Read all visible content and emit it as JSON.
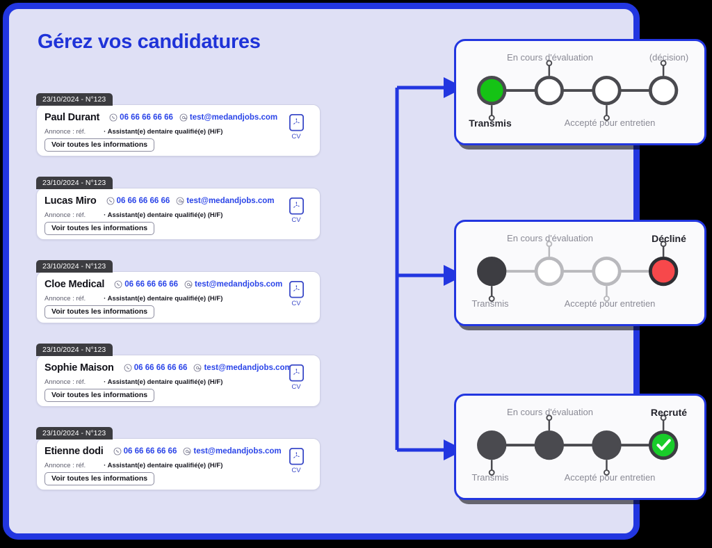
{
  "page": {
    "heading": "Gérez vos candidatures",
    "accent_blue": "#2236e0",
    "bg_panel": "#dfe0f5",
    "link_blue": "#2b45e8",
    "outer_bg": "#000000"
  },
  "candidates": [
    {
      "date_tag": "23/10/2024 - N°123",
      "name": "Paul Durant",
      "phone": "06 66 66 66 66",
      "email": "test@medandjobs.com",
      "annonce_label": "Annonce : réf.",
      "annonce_ref": "· Assistant(e) dentaire qualifié(e) (H/F)",
      "see_all": "Voir toutes les informations",
      "cv_label": "CV"
    },
    {
      "date_tag": "23/10/2024 - N°123",
      "name": "Lucas Miro",
      "phone": "06 66 66 66 66",
      "email": "test@medandjobs.com",
      "annonce_label": "Annonce : réf.",
      "annonce_ref": "· Assistant(e) dentaire qualifié(e) (H/F)",
      "see_all": "Voir toutes les informations",
      "cv_label": "CV"
    },
    {
      "date_tag": "23/10/2024 - N°123",
      "name": "Cloe Medical",
      "phone": "06 66 66 66 66",
      "email": "test@medandjobs.com",
      "annonce_label": "Annonce : réf.",
      "annonce_ref": "· Assistant(e) dentaire qualifié(e) (H/F)",
      "see_all": "Voir toutes les informations",
      "cv_label": "CV"
    },
    {
      "date_tag": "23/10/2024 - N°123",
      "name": "Sophie Maison",
      "phone": "06 66 66 66 66",
      "email": "test@medandjobs.com",
      "annonce_label": "Annonce : réf.",
      "annonce_ref": "· Assistant(e) dentaire qualifié(e) (H/F)",
      "see_all": "Voir toutes les informations",
      "cv_label": "CV"
    },
    {
      "date_tag": "23/10/2024 - N°123",
      "name": "Etienne dodi",
      "phone": "06 66 66 66 66",
      "email": "test@medandjobs.com",
      "annonce_label": "Annonce : réf.",
      "annonce_ref": "· Assistant(e) dentaire qualifié(e) (H/F)",
      "see_all": "Voir toutes les informations",
      "cv_label": "CV"
    }
  ],
  "status_panels": [
    {
      "id": "transmis",
      "labels_top": [
        "En cours d'évaluation",
        "(décision)"
      ],
      "labels_bottom": [
        "Transmis",
        "Accepté pour entretien"
      ],
      "active_label": "Transmis",
      "steps": [
        {
          "name": "Transmis",
          "state": "current",
          "fill": "#15c315",
          "ring": "#4a4a4f",
          "label_pos": "bottom",
          "label": "Transmis"
        },
        {
          "name": "En cours d'évaluation",
          "state": "pending",
          "fill": "#ffffff",
          "ring": "#4a4a4f",
          "label_pos": "top",
          "label": "En cours d'évaluation"
        },
        {
          "name": "Accepté pour entretien",
          "state": "pending",
          "fill": "#ffffff",
          "ring": "#4a4a4f",
          "label_pos": "bottom",
          "label": "Accepté pour entretien"
        },
        {
          "name": "(décision)",
          "state": "pending",
          "fill": "#ffffff",
          "ring": "#4a4a4f",
          "label_pos": "top",
          "label": "(décision)"
        }
      ]
    },
    {
      "id": "decline",
      "labels_top": [
        "En cours d'évaluation",
        "Décliné"
      ],
      "labels_bottom": [
        "Transmis",
        "Accepté pour entretien"
      ],
      "active_label": "Décliné",
      "steps": [
        {
          "name": "Transmis",
          "state": "done",
          "fill": "#3d3d42",
          "ring": "#3d3d42",
          "label_pos": "bottom",
          "label": "Transmis"
        },
        {
          "name": "En cours d'évaluation",
          "state": "skipped",
          "fill": "#ffffff",
          "ring": "#b9b9bd",
          "label_pos": "top",
          "label": "En cours d'évaluation"
        },
        {
          "name": "Accepté pour entretien",
          "state": "skipped",
          "fill": "#ffffff",
          "ring": "#b9b9bd",
          "label_pos": "bottom",
          "label": "Accepté pour entretien"
        },
        {
          "name": "Décliné",
          "state": "rejected",
          "fill": "#f7484b",
          "ring": "#2e2e33",
          "label_pos": "top",
          "label": "Décliné"
        }
      ]
    },
    {
      "id": "recrute",
      "labels_top": [
        "En cours d'évaluation",
        "Recruté"
      ],
      "labels_bottom": [
        "Transmis",
        "Accepté pour entretien"
      ],
      "active_label": "Recruté",
      "steps": [
        {
          "name": "Transmis",
          "state": "done",
          "fill": "#4a4a4f",
          "ring": "#4a4a4f",
          "label_pos": "bottom",
          "label": "Transmis"
        },
        {
          "name": "En cours d'évaluation",
          "state": "done",
          "fill": "#4a4a4f",
          "ring": "#4a4a4f",
          "label_pos": "top",
          "label": "En cours d'évaluation"
        },
        {
          "name": "Accepté pour entretien",
          "state": "done",
          "fill": "#4a4a4f",
          "ring": "#4a4a4f",
          "label_pos": "bottom",
          "label": "Accepté pour entretien"
        },
        {
          "name": "Recruté",
          "state": "hired",
          "fill": "#19cc2a",
          "ring": "#3d3d42",
          "label_pos": "top",
          "label": "Recruté"
        }
      ]
    }
  ],
  "icons": {
    "phone": "phone-icon",
    "email": "at-sign-icon",
    "cv": "pdf-file-icon",
    "check": "check-icon",
    "arrow": "arrow-right-icon"
  }
}
